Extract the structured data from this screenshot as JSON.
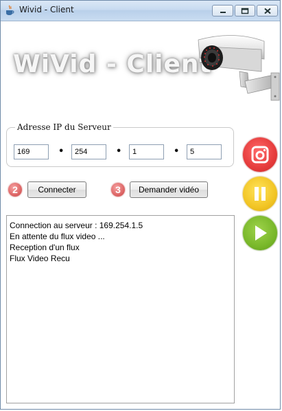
{
  "window": {
    "title": "Wivid - Client"
  },
  "header": {
    "logo_text": "WiVid - Client"
  },
  "server": {
    "legend": "Adresse IP du Serveur",
    "ip_octets": [
      "169",
      "254",
      "1",
      "5"
    ],
    "separators": [
      "•",
      "•",
      "•"
    ]
  },
  "actions": {
    "connect_step": "2",
    "connect_label": "Connecter",
    "request_step": "3",
    "request_label": "Demander vidéo"
  },
  "log": {
    "lines": [
      "Connection au serveur : 169.254.1.5",
      "En attente du flux video ...",
      "Reception d'un flux",
      "Flux Video Recu"
    ]
  },
  "side_controls": [
    {
      "name": "snapshot",
      "icon": "camera-icon",
      "color": "#e63c3c"
    },
    {
      "name": "pause",
      "icon": "pause-icon",
      "color": "#f2c525"
    },
    {
      "name": "play",
      "icon": "play-icon",
      "color": "#79b82a"
    }
  ]
}
